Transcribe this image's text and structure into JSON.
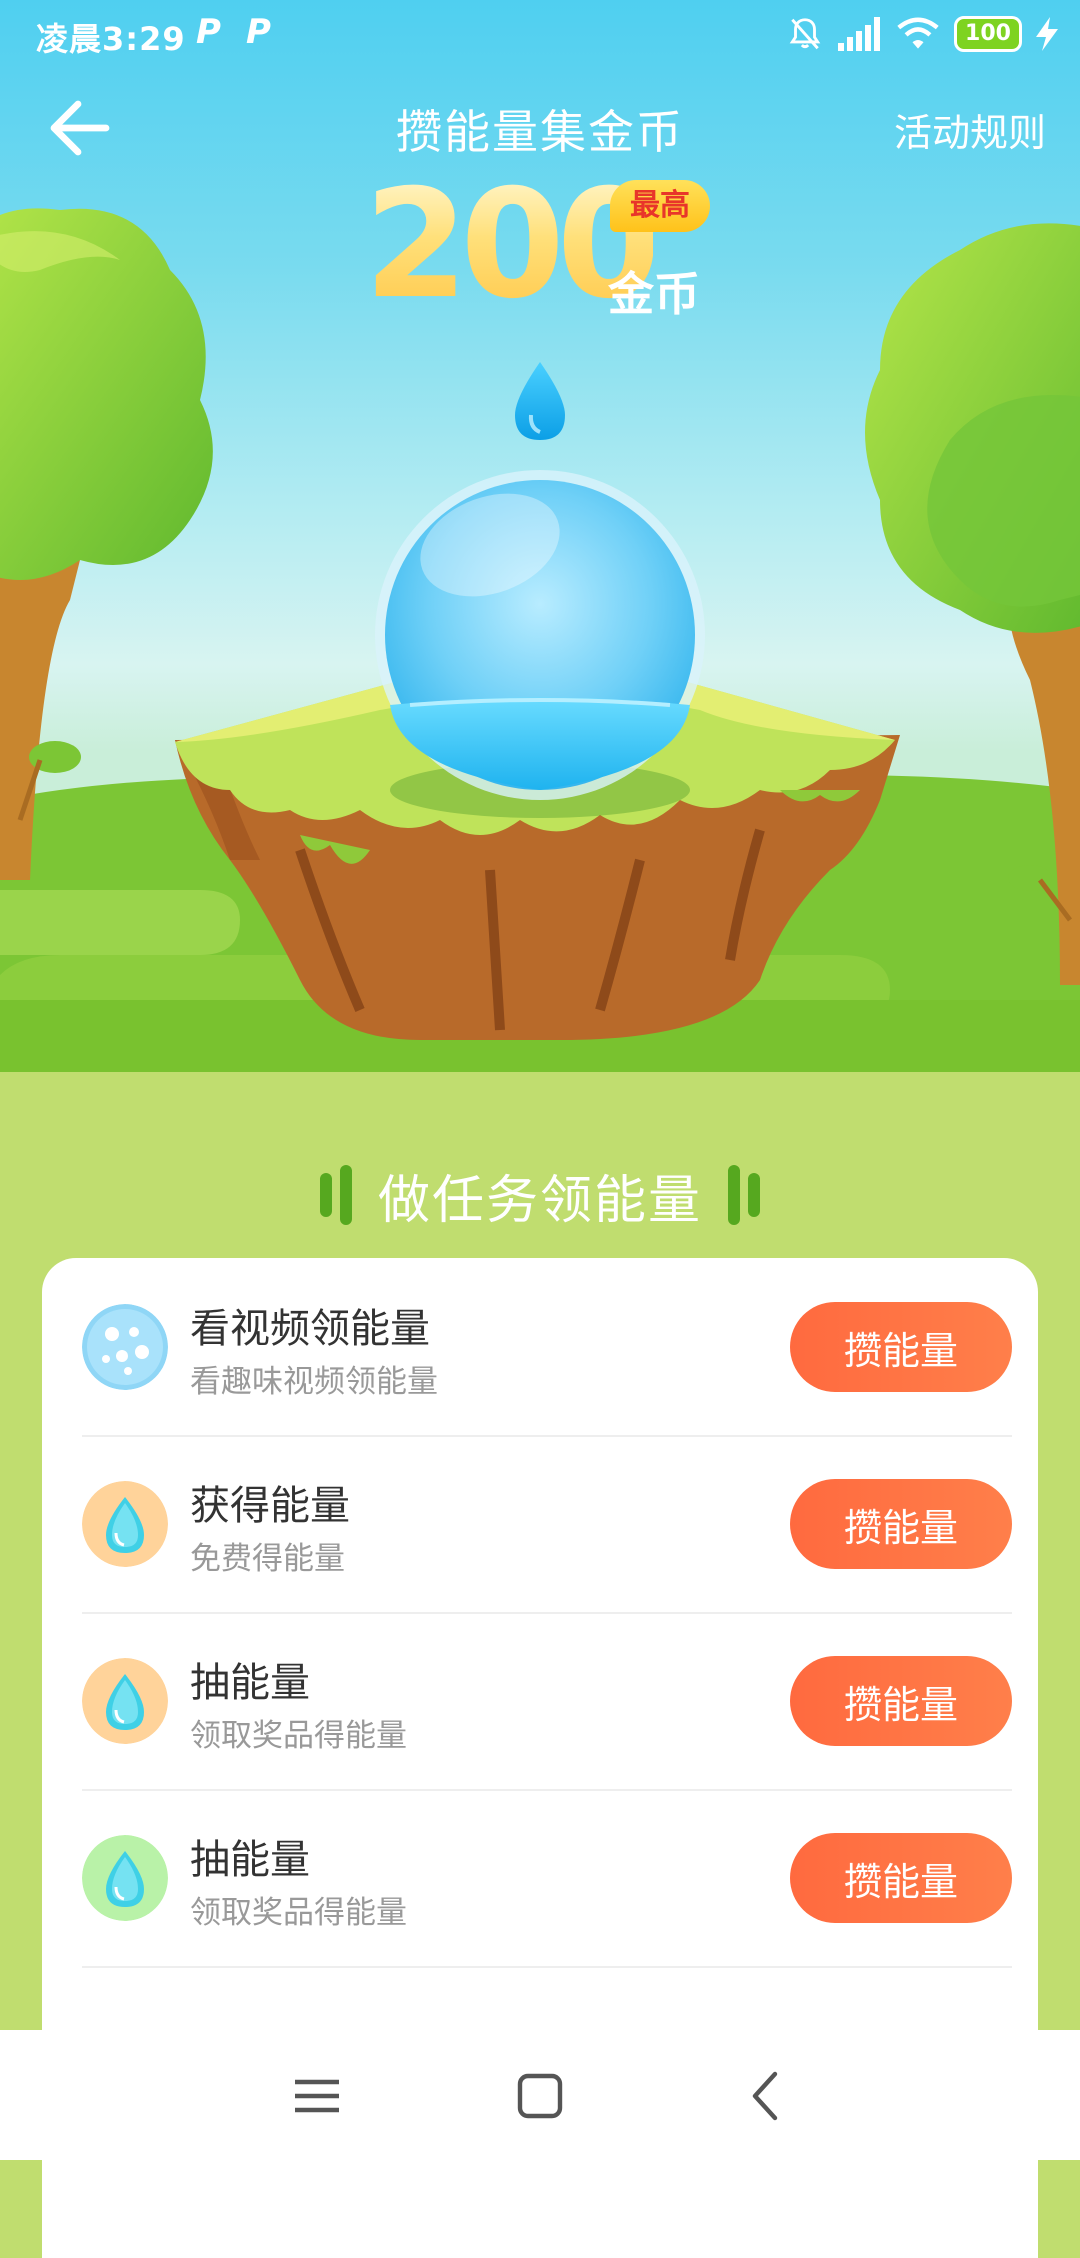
{
  "status_bar": {
    "time": "凌晨3:29",
    "notif_icons": [
      "P",
      "P"
    ],
    "battery": "100"
  },
  "header": {
    "title": "攒能量集金币",
    "rules_link": "活动规则"
  },
  "reward": {
    "amount": "200",
    "badge": "最高",
    "unit": "金币"
  },
  "section": {
    "title": "做任务领能量"
  },
  "tasks": [
    {
      "title": "看视频领能量",
      "subtitle": "看趣味视频领能量",
      "button": "攒能量",
      "icon": "bubbles-icon",
      "icon_color": "#8fd6f6"
    },
    {
      "title": "获得能量",
      "subtitle": "免费得能量",
      "button": "攒能量",
      "icon": "water-drop-icon",
      "icon_color": "#ffd39a"
    },
    {
      "title": "抽能量",
      "subtitle": "领取奖品得能量",
      "button": "攒能量",
      "icon": "water-drop-icon",
      "icon_color": "#ffd39a"
    },
    {
      "title": "抽能量",
      "subtitle": "领取奖品得能量",
      "button": "攒能量",
      "icon": "water-drop-icon",
      "icon_color": "#b9f2a8"
    }
  ],
  "colors": {
    "button": "#ff7043",
    "page_bg": "#c0dd6f",
    "grass": "#6fbf2f",
    "title_deco": "#56a81f"
  }
}
